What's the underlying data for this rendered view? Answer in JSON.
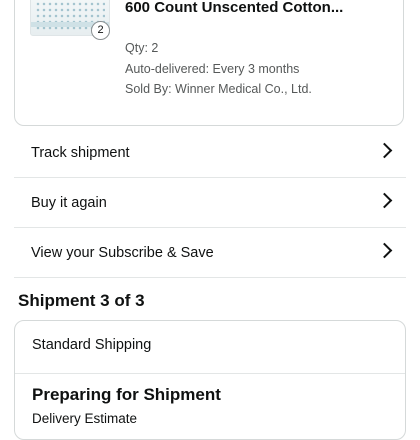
{
  "order_item": {
    "title": "600 Count Unscented Cotton...",
    "quantity_badge": "2",
    "qty": "Qty: 2",
    "auto_delivered": "Auto-delivered: Every 3 months",
    "sold_by": "Sold By: Winner Medical Co., Ltd."
  },
  "actions": {
    "track_shipment": "Track shipment",
    "buy_again": "Buy it again",
    "subscribe_save": "View your Subscribe & Save"
  },
  "shipment": {
    "heading": "Shipment 3 of 3",
    "method": "Standard Shipping",
    "status": "Preparing for Shipment",
    "delivery_estimate_label": "Delivery Estimate"
  },
  "colors": {
    "border": "#d5d9d9",
    "divider": "#e3e6e6",
    "text": "#0f1111",
    "secondary_text": "#565959"
  },
  "icons": {
    "row_chevron": "chevron-right-icon"
  }
}
